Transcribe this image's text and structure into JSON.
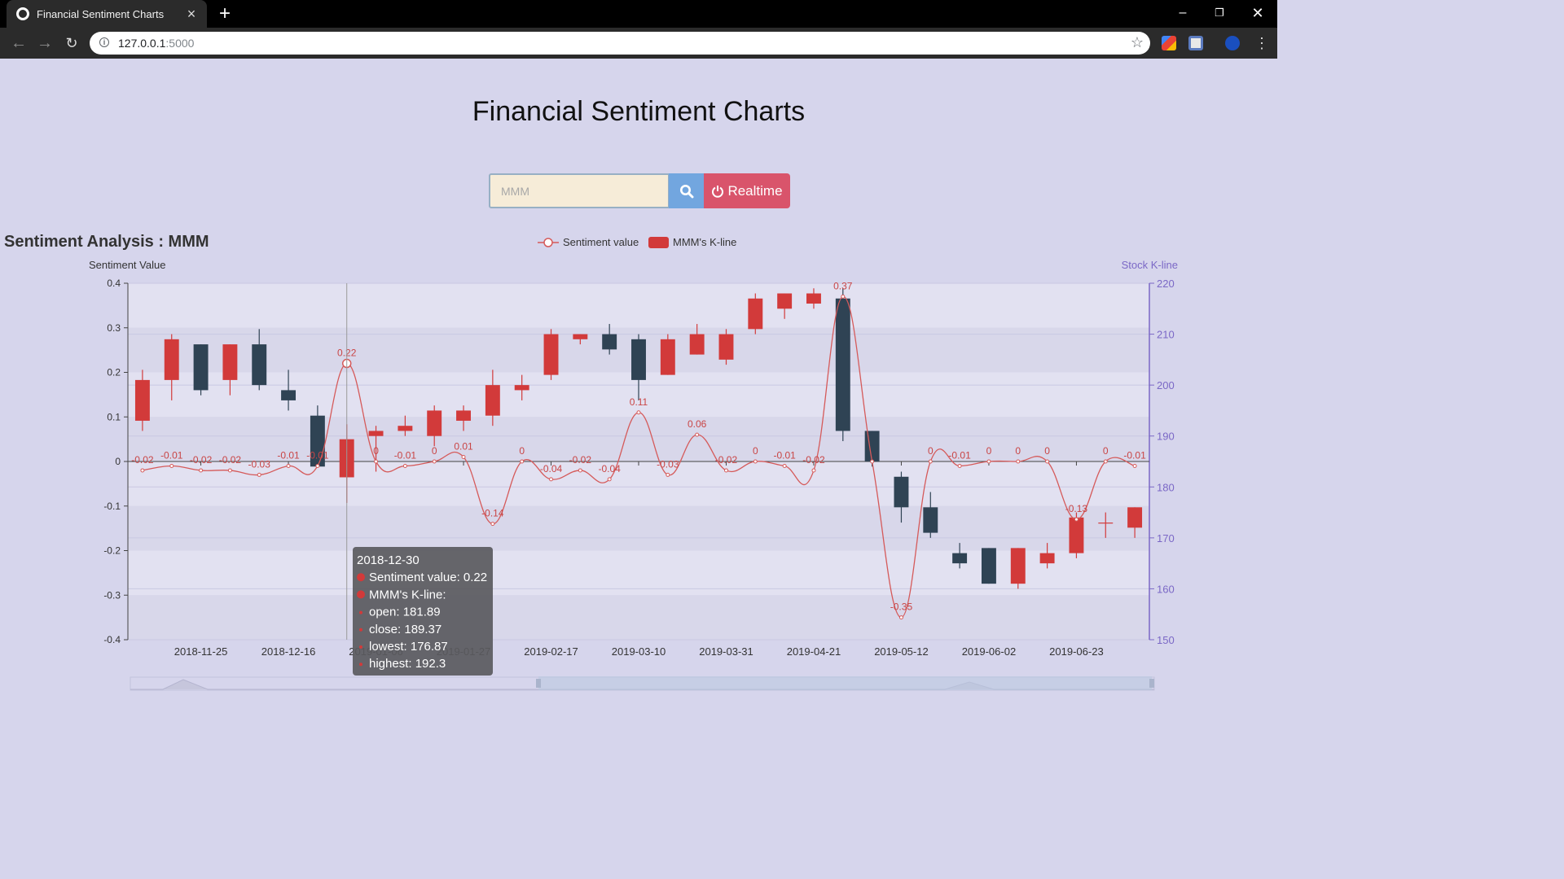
{
  "browser": {
    "tab_title": "Financial Sentiment Charts",
    "url_host": "127.0.0.1",
    "url_port": ":5000"
  },
  "page": {
    "title": "Financial Sentiment Charts",
    "search_placeholder": "MMM",
    "realtime_label": "Realtime",
    "chart_title": "Sentiment Analysis : MMM"
  },
  "chart_data": {
    "type": "line+candlestick",
    "legend": [
      "Sentiment value",
      "MMM's K-line"
    ],
    "legend_placement": "top-center",
    "y_left_label": "Sentiment Value",
    "y_right_label": "Stock K-line",
    "y_left_range": [
      -0.4,
      0.4
    ],
    "y_left_ticks": [
      "0.4",
      "0.3",
      "0.2",
      "0.1",
      "0",
      "-0.1",
      "-0.2",
      "-0.3",
      "-0.4"
    ],
    "y_right_range": [
      150,
      220
    ],
    "y_right_ticks": [
      "220",
      "210",
      "200",
      "190",
      "180",
      "170",
      "160",
      "150"
    ],
    "x_tick_labels": [
      "2018-11-25",
      "2018-12-16",
      "2019-01-06",
      "2019-01-27",
      "2019-02-17",
      "2019-03-10",
      "2019-03-31",
      "2019-04-21",
      "2019-05-12",
      "2019-06-02",
      "2019-06-23"
    ],
    "series": [
      {
        "name": "Sentiment value",
        "values": [
          -0.02,
          -0.01,
          -0.02,
          -0.02,
          -0.03,
          -0.01,
          -0.01,
          0.22,
          0,
          -0.01,
          0,
          0.01,
          -0.14,
          0,
          -0.04,
          -0.02,
          -0.04,
          0.11,
          -0.03,
          0.06,
          -0.02,
          0,
          -0.01,
          -0.02,
          0.37,
          0,
          -0.35,
          0,
          -0.01,
          0,
          0,
          0,
          -0.13,
          0,
          -0.01
        ],
        "labels": [
          "-0.02",
          "-0.01",
          "-0.02",
          "-0.02",
          "-0.03",
          "-0.01",
          "-0.01",
          "0.22",
          "0",
          "-0.01",
          "0",
          "0.01",
          "-0.14",
          "0",
          "-0.04",
          "-0.02",
          "-0.04",
          "0.11",
          "-0.03",
          "0.06",
          "-0.02",
          "0",
          "-0.01",
          "-0.02",
          "0.37",
          "",
          "-0.35",
          "0",
          "-0.01",
          "0",
          "0",
          "0",
          "-0.13",
          "0",
          "-0.01"
        ]
      },
      {
        "name": "MMM's K-line",
        "ohlc": [
          [
            193,
            201,
            191,
            203
          ],
          [
            201,
            209,
            197,
            210
          ],
          [
            208,
            199,
            198,
            208
          ],
          [
            201,
            208,
            198,
            208
          ],
          [
            208,
            200,
            199,
            211
          ],
          [
            199,
            197,
            195,
            203
          ],
          [
            194,
            184,
            184,
            196
          ],
          [
            181.89,
            189.37,
            176.87,
            192.3
          ],
          [
            190,
            191,
            183,
            192
          ],
          [
            191,
            192,
            190,
            194
          ],
          [
            190,
            195,
            188,
            196
          ],
          [
            193,
            195,
            191,
            196
          ],
          [
            194,
            200,
            192,
            203
          ],
          [
            199,
            200,
            197,
            202
          ],
          [
            202,
            210,
            201,
            211
          ],
          [
            209,
            210,
            208,
            210
          ],
          [
            210,
            207,
            206,
            212
          ],
          [
            209,
            201,
            197,
            210
          ],
          [
            202,
            209,
            202,
            210
          ],
          [
            206,
            210,
            206,
            212
          ],
          [
            205,
            210,
            204,
            211
          ],
          [
            211,
            217,
            210,
            218
          ],
          [
            215,
            218,
            213,
            218
          ],
          [
            216,
            218,
            215,
            219
          ],
          [
            217,
            191,
            189,
            219
          ],
          [
            191,
            185,
            184,
            191
          ],
          [
            182,
            176,
            173,
            183
          ],
          [
            176,
            171,
            170,
            179
          ],
          [
            167,
            165,
            164,
            169
          ],
          [
            168,
            161,
            161,
            168
          ],
          [
            161,
            168,
            160,
            168
          ],
          [
            165,
            167,
            164,
            169
          ],
          [
            167,
            174,
            166,
            175
          ],
          [
            173,
            173,
            170,
            175
          ],
          [
            172,
            176,
            170,
            176
          ]
        ]
      }
    ],
    "tooltip": {
      "date": "2018-12-30",
      "line1": "Sentiment value: 0.22",
      "line2": "MMM's K-line:",
      "line3": "open: 181.89",
      "line4": "close: 189.37",
      "line5": "lowest: 176.87",
      "line6": "highest: 192.3"
    },
    "colors": {
      "up": "#d23a3a",
      "down": "#2f4354",
      "sentiment_line": "#d55a5a",
      "right_axis": "#7b68c6"
    }
  }
}
